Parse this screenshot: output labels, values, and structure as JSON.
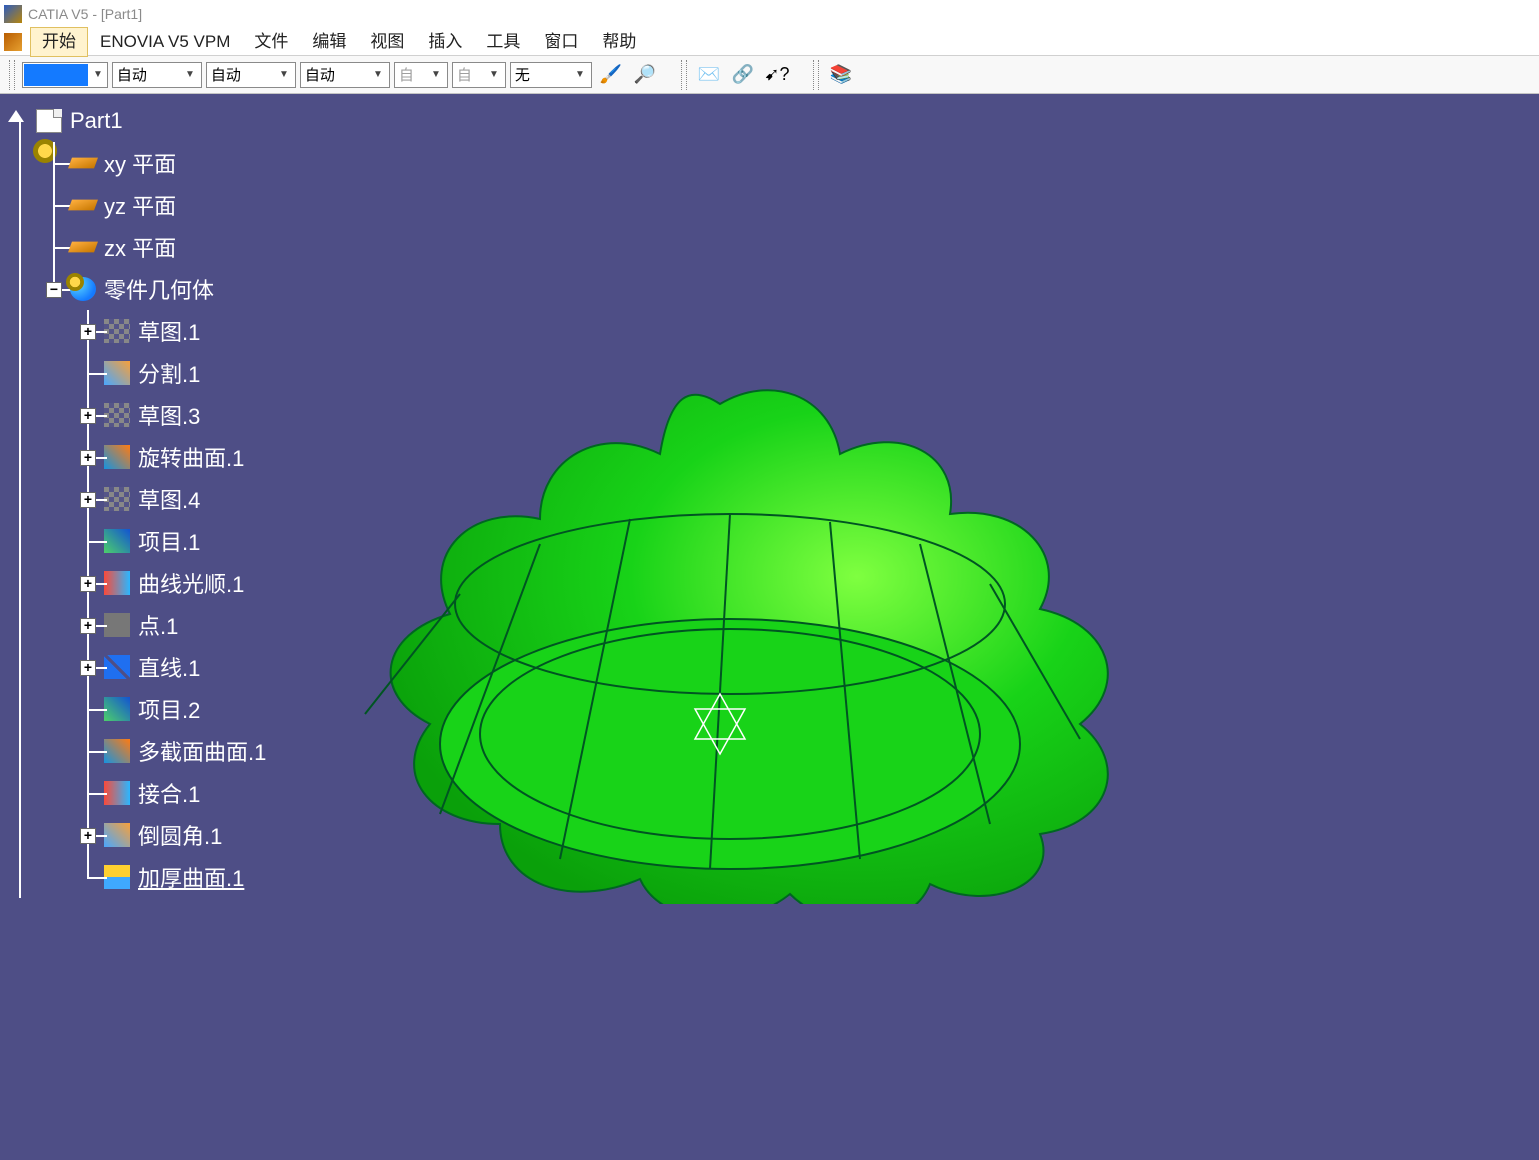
{
  "title": "CATIA V5 - [Part1]",
  "menu": {
    "start": "开始",
    "enovia": "ENOVIA V5 VPM",
    "file": "文件",
    "edit": "编辑",
    "view": "视图",
    "insert": "插入",
    "tools": "工具",
    "window": "窗口",
    "help": "帮助"
  },
  "toolbar": {
    "sel1": "自动",
    "sel2": "自动",
    "sel3": "自动",
    "sel4": "自",
    "sel5": "自",
    "sel6": "无"
  },
  "tree": {
    "root": "Part1",
    "xy": "xy 平面",
    "yz": "yz 平面",
    "zx": "zx 平面",
    "body": "零件几何体",
    "items": [
      {
        "label": "草图.1",
        "exp": true
      },
      {
        "label": "分割.1",
        "exp": false
      },
      {
        "label": "草图.3",
        "exp": true
      },
      {
        "label": "旋转曲面.1",
        "exp": true
      },
      {
        "label": "草图.4",
        "exp": true
      },
      {
        "label": "项目.1",
        "exp": false
      },
      {
        "label": "曲线光顺.1",
        "exp": true
      },
      {
        "label": "点.1",
        "exp": true
      },
      {
        "label": "直线.1",
        "exp": true
      },
      {
        "label": "项目.2",
        "exp": false
      },
      {
        "label": "多截面曲面.1",
        "exp": false
      },
      {
        "label": "接合.1",
        "exp": false
      },
      {
        "label": "倒圆角.1",
        "exp": true
      },
      {
        "label": "加厚曲面.1",
        "exp": false,
        "underline": true
      }
    ]
  }
}
